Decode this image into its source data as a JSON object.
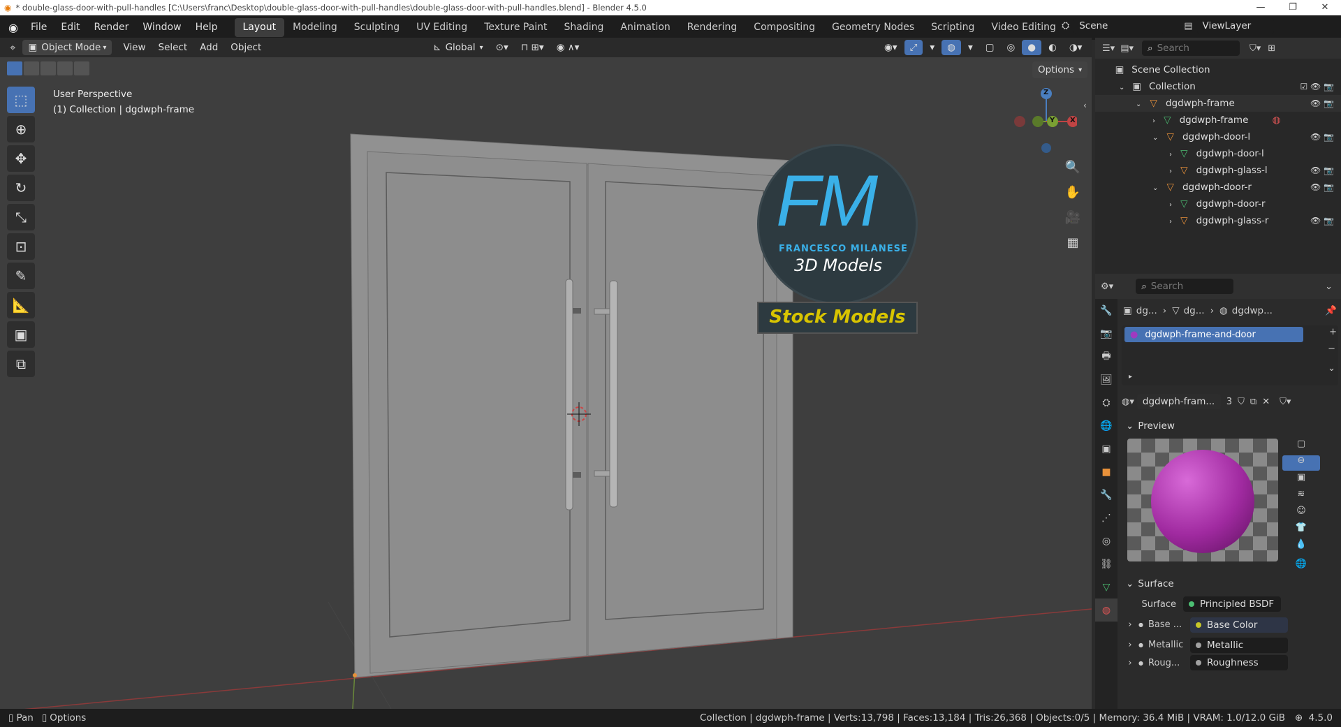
{
  "window": {
    "title": "* double-glass-door-with-pull-handles [C:\\Users\\franc\\Desktop\\double-glass-door-with-pull-handles\\double-glass-door-with-pull-handles.blend] - Blender 4.5.0",
    "controls": [
      "—",
      "❐",
      "✕"
    ]
  },
  "menus": [
    "File",
    "Edit",
    "Render",
    "Window",
    "Help"
  ],
  "workspaces": [
    "Layout",
    "Modeling",
    "Sculpting",
    "UV Editing",
    "Texture Paint",
    "Shading",
    "Animation",
    "Rendering",
    "Compositing",
    "Geometry Nodes",
    "Scripting",
    "Video Editing"
  ],
  "active_workspace": "Layout",
  "scene": {
    "label": "Scene",
    "viewlayer": "ViewLayer"
  },
  "viewport_header": {
    "mode": "Object Mode",
    "menus": [
      "View",
      "Select",
      "Add",
      "Object"
    ],
    "orientation": "Global",
    "options": "Options"
  },
  "viewport": {
    "perspective": "User Perspective",
    "context": "(1) Collection | dgdwph-frame",
    "axis_labels": {
      "x": "X",
      "y": "Y",
      "z": "Z"
    },
    "logo": {
      "letters": "FM",
      "name": "FRANCESCO MILANESE",
      "sub": "3D Models",
      "banner": "Stock Models"
    }
  },
  "outliner": {
    "search_placeholder": "Search",
    "rows": [
      {
        "label": "Scene Collection",
        "indent": 0,
        "icon": "scene-collection-icon"
      },
      {
        "label": "Collection",
        "indent": 1,
        "icon": "collection-icon"
      },
      {
        "label": "dgdwph-frame",
        "indent": 2,
        "icon": "object-icon"
      },
      {
        "label": "dgdwph-frame",
        "indent": 3,
        "icon": "mesh-icon"
      },
      {
        "label": "dgdwph-door-l",
        "indent": 3,
        "icon": "object-icon"
      },
      {
        "label": "dgdwph-door-l",
        "indent": 4,
        "icon": "mesh-icon"
      },
      {
        "label": "dgdwph-glass-l",
        "indent": 4,
        "icon": "object-icon"
      },
      {
        "label": "dgdwph-door-r",
        "indent": 3,
        "icon": "object-icon"
      },
      {
        "label": "dgdwph-door-r",
        "indent": 4,
        "icon": "mesh-icon"
      },
      {
        "label": "dgdwph-glass-r",
        "indent": 4,
        "icon": "object-icon"
      }
    ]
  },
  "properties": {
    "search_placeholder": "Search",
    "breadcrumb": [
      "dg...",
      "dg...",
      "dgdwp..."
    ],
    "material_slot": "dgdwph-frame-and-door",
    "material_name": "dgdwph-fram...",
    "user_count": "3",
    "preview_label": "Preview",
    "surface_label": "Surface",
    "surface_field_label": "Surface",
    "surface_value": "Principled BSDF",
    "inputs": [
      {
        "label": "Base ...",
        "value": "Base Color",
        "dot": "#c7c729"
      },
      {
        "label": "Metallic",
        "value": "Metallic",
        "dot": "#a1a1a1"
      },
      {
        "label": "Roug...",
        "value": "Roughness",
        "dot": "#a1a1a1"
      }
    ]
  },
  "statusbar": {
    "left": [
      "Pan",
      "Options"
    ],
    "info": "Collection | dgdwph-frame | Verts:13,798 | Faces:13,184 | Tris:26,368 | Objects:0/5 | Memory: 36.4 MiB | VRAM: 1.0/12.0 GiB",
    "version": "4.5.0"
  },
  "colors": {
    "accent": "#4772b3",
    "object_icon": "#e8913a",
    "mesh_icon": "#4cbf73",
    "logo_blue": "#3ab0e8",
    "banner_text": "#d8c400"
  }
}
